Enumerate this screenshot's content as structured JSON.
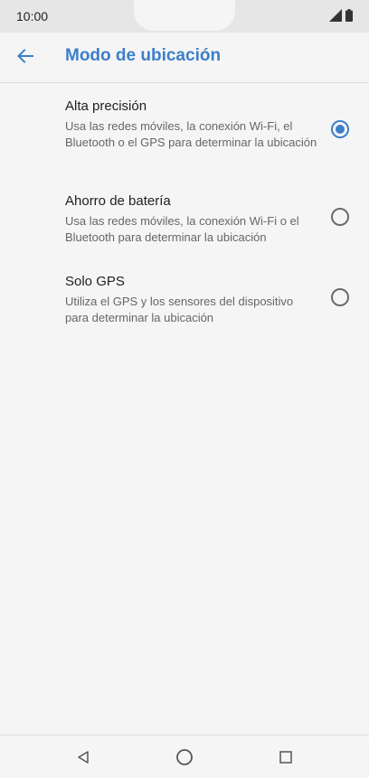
{
  "status_bar": {
    "time": "10:00",
    "icons": [
      "signal-icon",
      "battery-icon"
    ]
  },
  "app_bar": {
    "back_icon": "arrow-left-icon",
    "title": "Modo de ubicación"
  },
  "options": [
    {
      "title": "Alta precisión",
      "description": "Usa las redes móviles, la conexión Wi-Fi, el Bluetooth o el GPS para determinar la ubicación",
      "selected": true
    },
    {
      "title": "Ahorro de batería",
      "description": "Usa las redes móviles, la conexión Wi-Fi o el Bluetooth para determinar la ubicación",
      "selected": false
    },
    {
      "title": "Solo GPS",
      "description": "Utiliza el GPS y los sensores del dispositivo para determinar la ubicación",
      "selected": false
    }
  ],
  "nav_bar": {
    "icons": [
      "back-triangle-icon",
      "home-circle-icon",
      "recents-square-icon"
    ]
  },
  "colors": {
    "accent": "#3d7fc9",
    "background": "#f5f5f5",
    "status_bar": "#e6e6e6"
  }
}
